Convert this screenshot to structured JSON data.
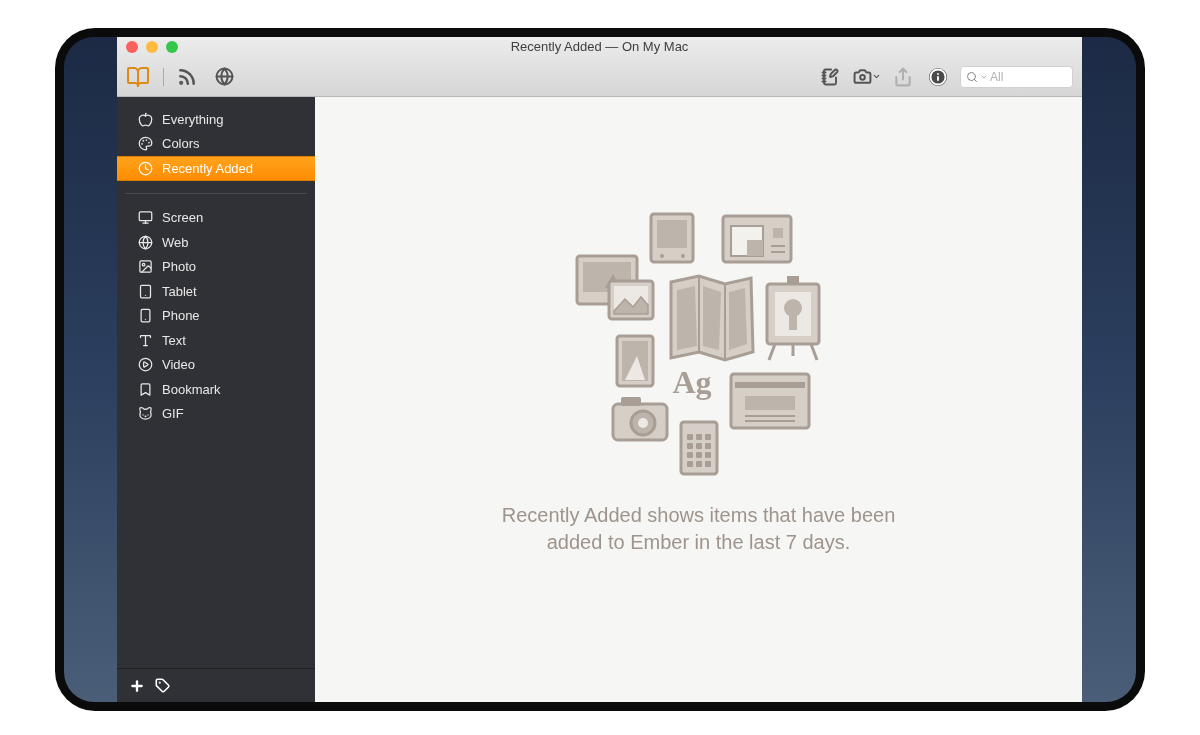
{
  "window": {
    "title": "Recently Added — On My Mac"
  },
  "search": {
    "placeholder": "All"
  },
  "sidebar": {
    "library": [
      {
        "label": "Everything",
        "selected": false
      },
      {
        "label": "Colors",
        "selected": false
      },
      {
        "label": "Recently Added",
        "selected": true
      }
    ],
    "types": [
      {
        "label": "Screen",
        "selected": false
      },
      {
        "label": "Web",
        "selected": false
      },
      {
        "label": "Photo",
        "selected": false
      },
      {
        "label": "Tablet",
        "selected": false
      },
      {
        "label": "Phone",
        "selected": false
      },
      {
        "label": "Text",
        "selected": false
      },
      {
        "label": "Video",
        "selected": false
      },
      {
        "label": "Bookmark",
        "selected": false
      },
      {
        "label": "GIF",
        "selected": false
      }
    ]
  },
  "empty_state": {
    "artwork_text": "Ag",
    "message": "Recently Added shows items that have been added to Ember in the last 7 days."
  }
}
